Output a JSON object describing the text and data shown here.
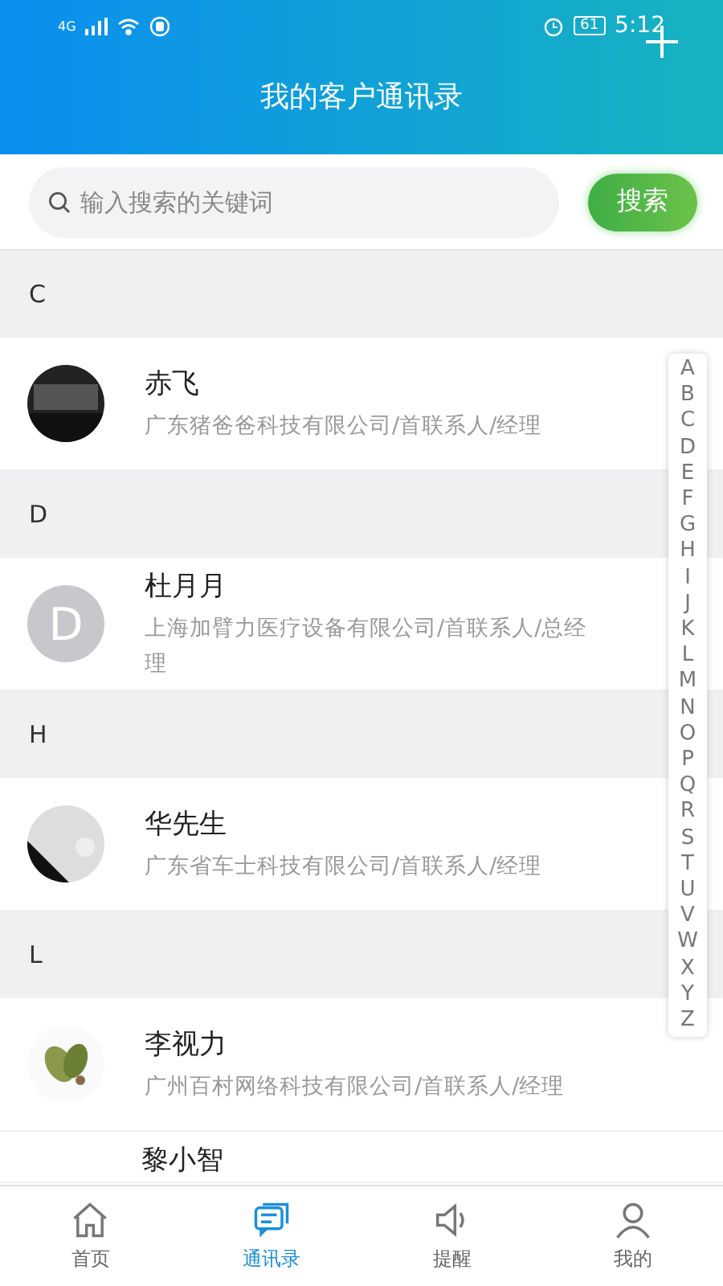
{
  "status_bar": {
    "network": "4G",
    "battery": "61",
    "time": "5:12"
  },
  "header": {
    "title": "我的客户通讯录"
  },
  "search": {
    "placeholder": "输入搜索的关键词",
    "button": "搜索"
  },
  "sections": [
    {
      "letter": "C",
      "contacts": [
        {
          "name": "赤飞",
          "detail": "广东猪爸爸科技有限公司/首联系人/经理"
        }
      ]
    },
    {
      "letter": "D",
      "contacts": [
        {
          "name": "杜月月",
          "detail": "上海加臂力医疗设备有限公司/首联系人/总经理",
          "avatar": {
            "kind": "letter",
            "text": "D"
          }
        }
      ]
    },
    {
      "letter": "H",
      "contacts": [
        {
          "name": "华先生",
          "detail": "广东省车士科技有限公司/首联系人/经理"
        }
      ]
    },
    {
      "letter": "L",
      "contacts": [
        {
          "name": "李视力",
          "detail": "广州百村网络科技有限公司/首联系人/经理"
        },
        {
          "name": "黎小智",
          "avatar": {
            "kind": "none"
          }
        }
      ]
    }
  ],
  "index": [
    "A",
    "B",
    "C",
    "D",
    "E",
    "F",
    "G",
    "H",
    "I",
    "J",
    "K",
    "L",
    "M",
    "N",
    "O",
    "P",
    "Q",
    "R",
    "S",
    "T",
    "U",
    "V",
    "W",
    "X",
    "Y",
    "Z"
  ],
  "tabs": [
    {
      "label": "首页",
      "selected": false
    },
    {
      "label": "通讯录",
      "selected": true
    },
    {
      "label": "提醒",
      "selected": false
    },
    {
      "label": "我的",
      "selected": false
    }
  ]
}
